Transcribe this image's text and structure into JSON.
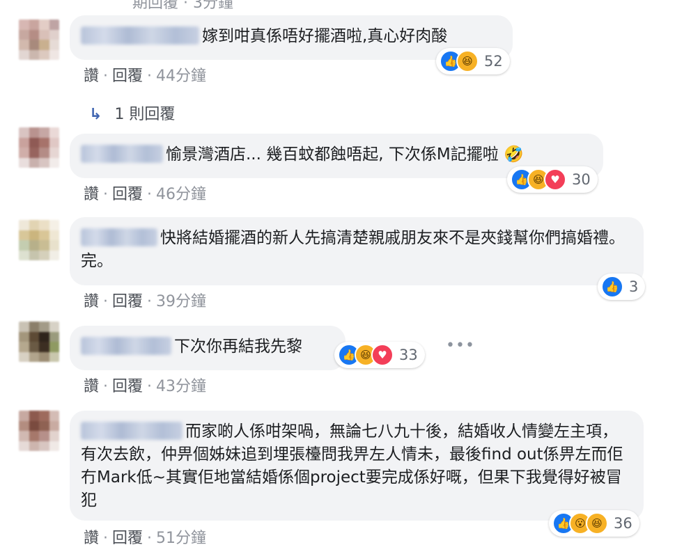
{
  "top_remnant": "期回覆 · 3分鐘",
  "actions": {
    "like": "讚",
    "reply": "回覆",
    "sep": "·"
  },
  "icons": {
    "reply_arrow": "reply-arrow-icon",
    "more": "more-options-icon"
  },
  "colors": {
    "like": "#1877f2",
    "haha": "#f7b125",
    "love": "#f33e58",
    "bubble": "#f2f3f5"
  },
  "comments": [
    {
      "text": "嫁到咁真係唔好擺酒啦,真心好肉酸",
      "time": "44分鐘",
      "reactions": [
        "like",
        "haha"
      ],
      "count": "52"
    },
    {
      "text": "愉景灣酒店... 幾百蚊都蝕唔起, 下次係M記擺啦 🤣",
      "time": "46分鐘",
      "reactions": [
        "like",
        "haha",
        "love"
      ],
      "count": "30"
    },
    {
      "text": "快將結婚擺酒的新人先搞清楚親戚朋友來不是夾錢幫你們搞婚禮。完。",
      "time": "39分鐘",
      "reactions": [
        "like"
      ],
      "count": "3"
    },
    {
      "text": "下次你再結我先黎",
      "time": "43分鐘",
      "reactions": [
        "like",
        "haha",
        "love"
      ],
      "count": "33"
    },
    {
      "text": "而家啲人係咁架喎，無論七八九十後，結婚收人情變左主項，有次去飲，仲畀個姊妹追到埋張檯問我畀左人情未，最後find out係畀左而佢冇Mark低~其實佢地當結婚係個project要完成係好嘅，但果下我覺得好被冒犯",
      "time": "51分鐘",
      "reactions": [
        "like",
        "wow",
        "haha"
      ],
      "count": "36"
    }
  ],
  "replies_link": "1 則回覆"
}
